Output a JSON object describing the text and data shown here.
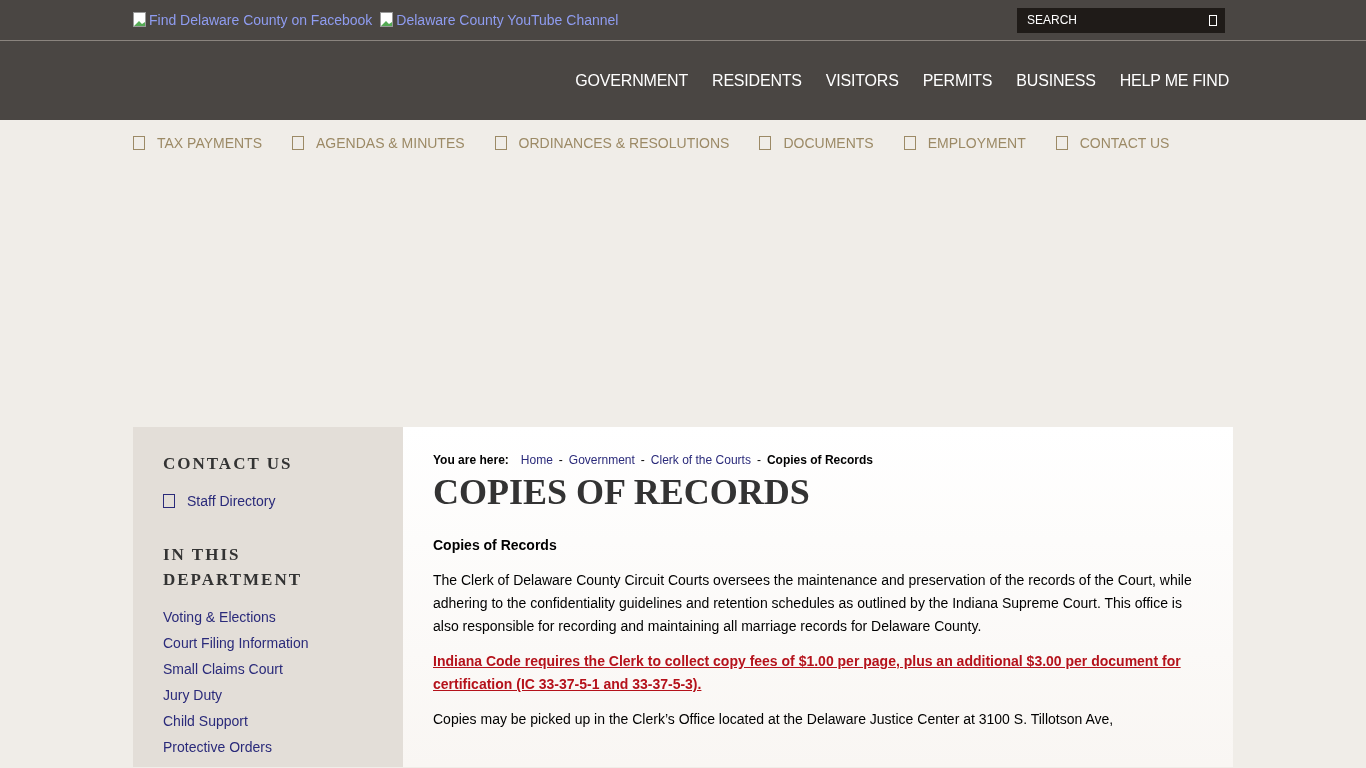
{
  "social_links": [
    {
      "label": "Find Delaware County on Facebook"
    },
    {
      "label": "Delaware County YouTube Channel"
    }
  ],
  "search": {
    "placeholder": "SEARCH"
  },
  "main_nav": [
    "GOVERNMENT",
    "RESIDENTS",
    "VISITORS",
    "PERMITS",
    "BUSINESS",
    "HELP ME FIND"
  ],
  "quick_links": [
    "TAX PAYMENTS",
    "AGENDAS & MINUTES",
    "ORDINANCES & RESOLUTIONS",
    "DOCUMENTS",
    "EMPLOYMENT",
    "CONTACT US"
  ],
  "sidebar": {
    "contact_heading": "CONTACT US",
    "contact_link": "Staff Directory",
    "department_heading": "IN THIS DEPARTMENT",
    "items": [
      "Voting & Elections",
      "Court Filing Information",
      "Small Claims Court",
      "Jury Duty",
      "Child Support",
      "Protective Orders"
    ]
  },
  "breadcrumb": {
    "label": "You are here:",
    "links": [
      "Home",
      "Government",
      "Clerk of the Courts"
    ],
    "separator": "-",
    "current": "Copies of Records"
  },
  "page_title": "COPIES OF RECORDS",
  "content": [
    {
      "kind": "heading",
      "text": "Copies of Records"
    },
    {
      "kind": "paragraph",
      "text": "The Clerk of Delaware County Circuit Courts oversees the maintenance and preservation of the records of the Court, while adhering to the confidentiality guidelines and retention schedules as outlined by the Indiana Supreme Court. This office is also responsible for recording and maintaining all marriage records for Delaware County."
    },
    {
      "kind": "notice",
      "text": "Indiana Code requires the Clerk to collect copy fees of $1.00 per page, plus an additional $3.00 per document for certification (IC 33-37-5-1 and 33-37-5-3)."
    },
    {
      "kind": "paragraph",
      "text": "Copies may be picked up in the Clerk’s Office located at the Delaware Justice Center at 3100 S. Tillotson Ave,"
    }
  ]
}
